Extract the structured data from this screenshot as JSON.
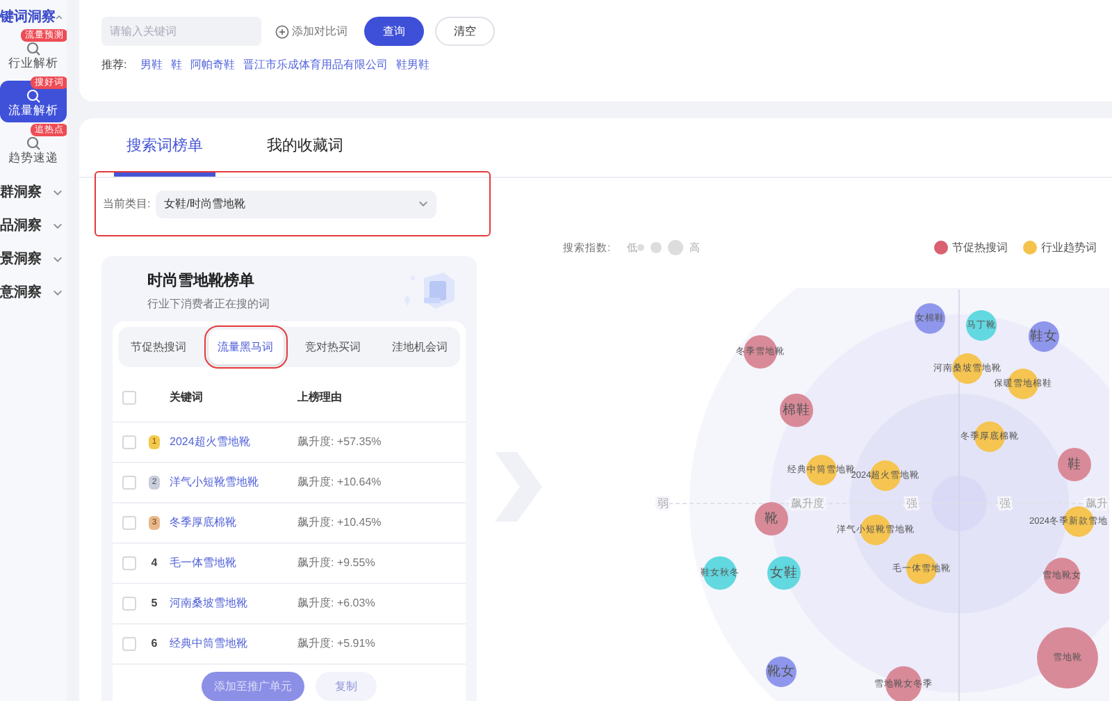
{
  "sidebar": {
    "groups": [
      {
        "label": "键词洞察",
        "expanded": true,
        "items": [
          {
            "label": "行业解析",
            "badge": "流量预测",
            "selected": false
          },
          {
            "label": "流量解析",
            "badge": "搜好词",
            "selected": true
          },
          {
            "label": "趋势速递",
            "badge": "追热点",
            "selected": false
          }
        ]
      },
      {
        "label": "群洞察",
        "expanded": false
      },
      {
        "label": "品洞察",
        "expanded": false
      },
      {
        "label": "景洞察",
        "expanded": false
      },
      {
        "label": "意洞察",
        "expanded": false
      }
    ]
  },
  "search": {
    "placeholder": "请输入关键词",
    "add_compare": "添加对比词",
    "buttons": [
      {
        "label": "查询",
        "kind": "primary"
      },
      {
        "label": "清空",
        "kind": "outline"
      }
    ],
    "recommend_label": "推荐:",
    "recommendations": [
      "男鞋",
      "鞋",
      "阿帕奇鞋",
      "晋江市乐成体育用品有限公司",
      "鞋男鞋"
    ]
  },
  "tabs": [
    {
      "label": "搜索词榜单",
      "selected": true
    },
    {
      "label": "我的收藏词",
      "selected": false
    }
  ],
  "category": {
    "label": "当前类目:",
    "value": "女鞋/时尚雪地靴",
    "highlighted": true
  },
  "ranking": {
    "title": "时尚雪地靴榜单",
    "subtitle": "行业下消费者正在搜的词",
    "tabs": [
      {
        "label": "节促热搜词",
        "selected": false,
        "highlighted": false
      },
      {
        "label": "流量黑马词",
        "selected": true,
        "highlighted": true
      },
      {
        "label": "竞对热买词",
        "selected": false,
        "highlighted": false
      },
      {
        "label": "洼地机会词",
        "selected": false,
        "highlighted": false
      }
    ],
    "columns": [
      "关键词",
      "上榜理由"
    ],
    "all_checked": false,
    "rows": [
      {
        "rank": "1",
        "kind": "gold",
        "keyword": "2024超火雪地靴",
        "reason": "飙升度: +57.35%",
        "checked": false
      },
      {
        "rank": "2",
        "kind": "silver",
        "keyword": "洋气小短靴雪地靴",
        "reason": "飙升度: +10.64%",
        "checked": false
      },
      {
        "rank": "3",
        "kind": "bronze",
        "keyword": "冬季厚底棉靴",
        "reason": "飙升度: +10.45%",
        "checked": false
      },
      {
        "rank": "4",
        "kind": "plain",
        "keyword": "毛一体雪地靴",
        "reason": "飙升度: +9.55%",
        "checked": false
      },
      {
        "rank": "5",
        "kind": "plain",
        "keyword": "河南桑坡雪地靴",
        "reason": "飙升度: +6.03%",
        "checked": false
      },
      {
        "rank": "6",
        "kind": "plain",
        "keyword": "经典中筒雪地靴",
        "reason": "飙升度: +5.91%",
        "checked": false
      }
    ],
    "actions": [
      {
        "label": "添加至推广单元",
        "kind": "primary"
      },
      {
        "label": "复制",
        "kind": "secondary"
      }
    ]
  },
  "bubble_chart": {
    "size_legend": {
      "label": "搜索指数:",
      "low": "低",
      "high": "高"
    },
    "legend": [
      {
        "label": "节促热搜词",
        "color": "#d9606f"
      },
      {
        "label": "行业趋势词",
        "color": "#f5c24c"
      }
    ],
    "axis_labels": [
      "弱",
      "飙升度",
      "强",
      "强",
      "飙升"
    ],
    "bubbles": [
      {
        "label": "女棉鞋",
        "color": "#8e97ec"
      },
      {
        "label": "马丁靴",
        "color": "#62d8e0"
      },
      {
        "label": "鞋女",
        "color": "#8e97ec"
      },
      {
        "label": "冬季雪地靴",
        "color": "#d98a98"
      },
      {
        "label": "河南桑坡雪地靴",
        "color": "#f5c451"
      },
      {
        "label": "保暖雪地棉鞋",
        "color": "#f5c451"
      },
      {
        "label": "棉鞋",
        "color": "#d98a98"
      },
      {
        "label": "冬季厚底棉靴",
        "color": "#f5c451"
      },
      {
        "label": "鞋",
        "color": "#d98a98"
      },
      {
        "label": "经典中筒雪地靴",
        "color": "#f5c451"
      },
      {
        "label": "2024超火雪地靴",
        "color": "#f5c451"
      },
      {
        "label": "靴",
        "color": "#d98a98"
      },
      {
        "label": "洋气小短靴雪地靴",
        "color": "#f5c451"
      },
      {
        "label": "2024冬季新款雪地",
        "color": "#f5c451"
      },
      {
        "label": "毛一体雪地靴",
        "color": "#f5c451"
      },
      {
        "label": "鞋女秋冬",
        "color": "#62d8e0"
      },
      {
        "label": "女鞋",
        "color": "#62d8e0"
      },
      {
        "label": "雪地靴女",
        "color": "#d98a98"
      },
      {
        "label": "雪地靴",
        "color": "#d98a98"
      },
      {
        "label": "靴女",
        "color": "#8e97ec"
      },
      {
        "label": "雪地靴女冬季",
        "color": "#d98a98"
      }
    ]
  }
}
